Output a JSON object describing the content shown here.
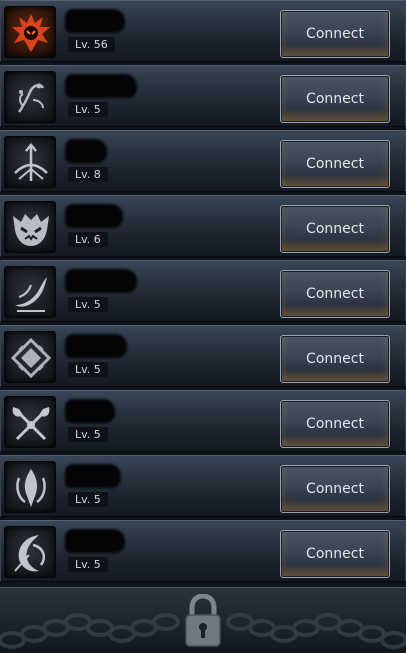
{
  "characters": [
    {
      "level": "Lv. 56",
      "connect_label": "Connect",
      "class_icon": "flame-demon-crest-icon",
      "selected": true
    },
    {
      "level": "Lv. 5",
      "connect_label": "Connect",
      "class_icon": "vine-spirit-icon",
      "selected": false
    },
    {
      "level": "Lv. 8",
      "connect_label": "Connect",
      "class_icon": "bow-arrow-icon",
      "selected": false
    },
    {
      "level": "Lv. 6",
      "connect_label": "Connect",
      "class_icon": "demon-mask-icon",
      "selected": false
    },
    {
      "level": "Lv. 5",
      "connect_label": "Connect",
      "class_icon": "wind-wave-icon",
      "selected": false
    },
    {
      "level": "Lv. 5",
      "connect_label": "Connect",
      "class_icon": "diamond-rune-icon",
      "selected": false
    },
    {
      "level": "Lv. 5",
      "connect_label": "Connect",
      "class_icon": "twin-axe-icon",
      "selected": false
    },
    {
      "level": "Lv. 5",
      "connect_label": "Connect",
      "class_icon": "flame-blade-icon",
      "selected": false
    },
    {
      "level": "Lv. 5",
      "connect_label": "Connect",
      "class_icon": "crescent-moon-icon",
      "selected": false
    }
  ],
  "locked_slot": {
    "icon": "padlock-icon"
  },
  "colors": {
    "row_top": "#394657",
    "row_bottom": "#141920",
    "button_border": "#9aa4b3",
    "text": "#e3e6ea",
    "active_icon": "#d9431c"
  }
}
